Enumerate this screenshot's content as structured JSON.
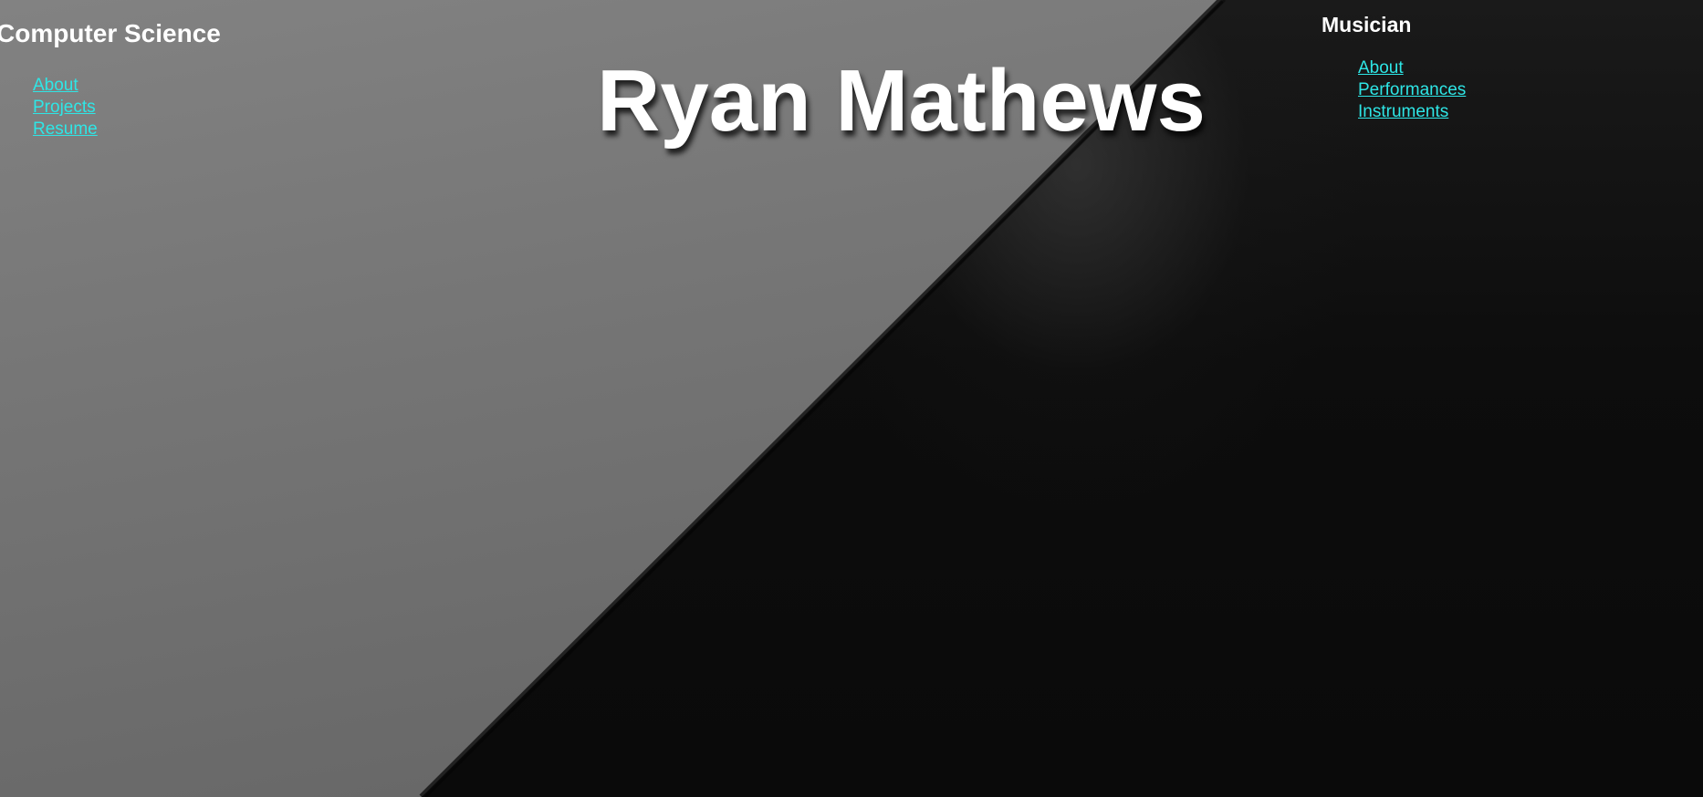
{
  "header": {
    "title": "Ryan Mathews"
  },
  "computer_science": {
    "heading": "Computer Science",
    "links": [
      {
        "label": "About"
      },
      {
        "label": "Projects"
      },
      {
        "label": "Resume"
      }
    ]
  },
  "musician": {
    "heading": "Musician",
    "links": [
      {
        "label": "About"
      },
      {
        "label": "Performances"
      },
      {
        "label": "Instruments"
      }
    ]
  },
  "colors": {
    "link": "#2ee6e6",
    "heading": "#ffffff",
    "background_light": "#767676",
    "background_dark": "#0b0b0b"
  }
}
